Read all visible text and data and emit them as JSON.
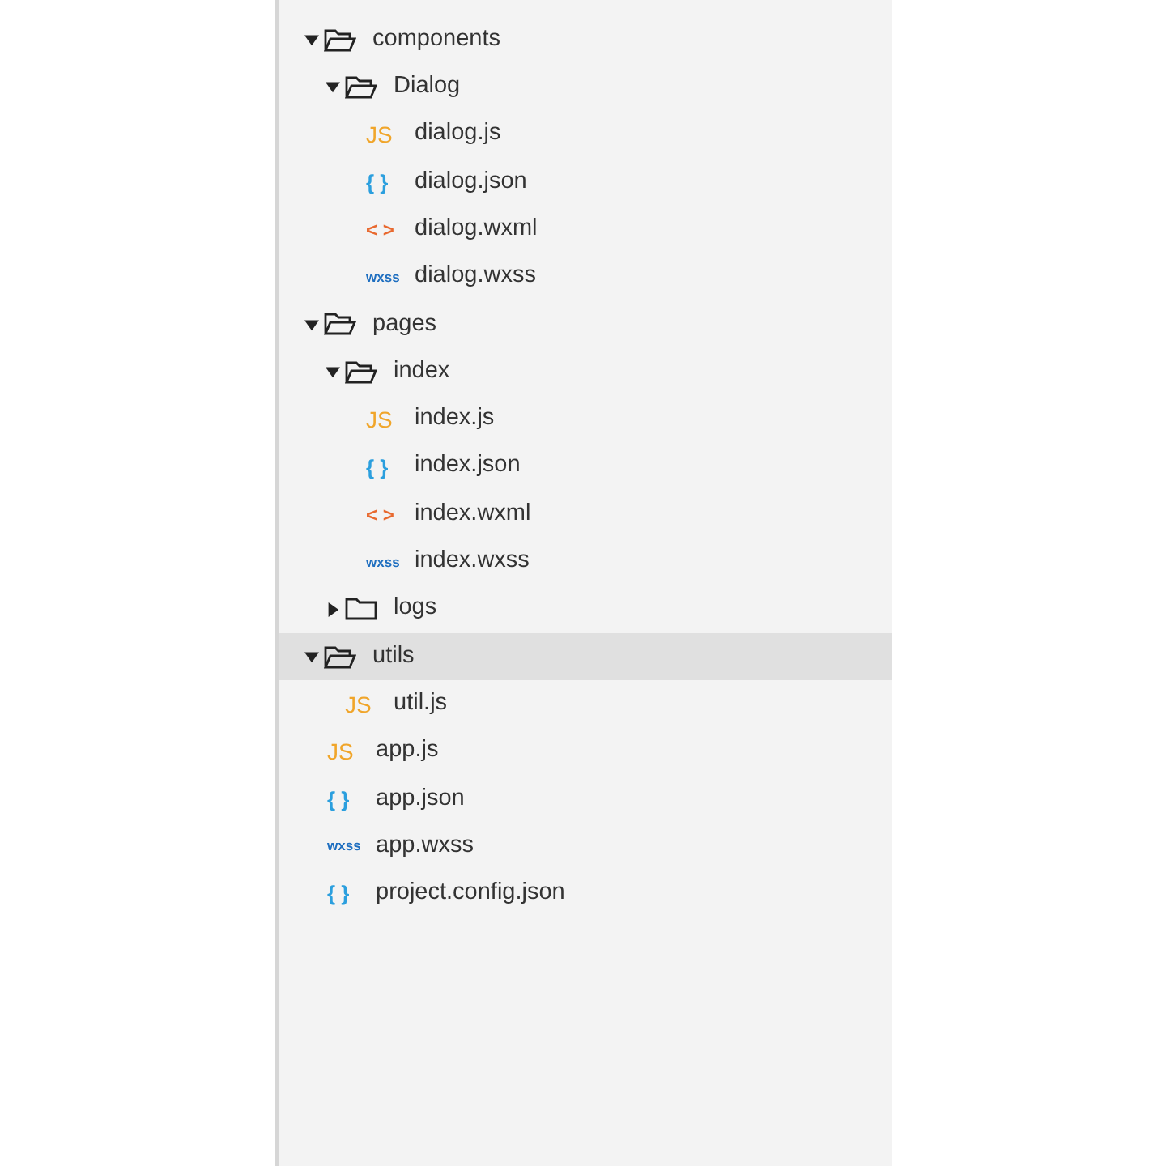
{
  "file_tree": [
    {
      "kind": "folder",
      "label": "components",
      "expanded": true,
      "selected": false,
      "children": [
        {
          "kind": "folder",
          "label": "Dialog",
          "expanded": true,
          "selected": false,
          "children": [
            {
              "kind": "js",
              "badge": "JS",
              "label": "dialog.js",
              "selected": false
            },
            {
              "kind": "json",
              "badge": "{ }",
              "label": "dialog.json",
              "selected": false
            },
            {
              "kind": "wxml",
              "badge": "< >",
              "label": "dialog.wxml",
              "selected": false
            },
            {
              "kind": "wxss",
              "badge": "wxss",
              "label": "dialog.wxss",
              "selected": false
            }
          ]
        }
      ]
    },
    {
      "kind": "folder",
      "label": "pages",
      "expanded": true,
      "selected": false,
      "children": [
        {
          "kind": "folder",
          "label": "index",
          "expanded": true,
          "selected": false,
          "children": [
            {
              "kind": "js",
              "badge": "JS",
              "label": "index.js",
              "selected": false
            },
            {
              "kind": "json",
              "badge": "{ }",
              "label": "index.json",
              "selected": false
            },
            {
              "kind": "wxml",
              "badge": "< >",
              "label": "index.wxml",
              "selected": false
            },
            {
              "kind": "wxss",
              "badge": "wxss",
              "label": "index.wxss",
              "selected": false
            }
          ]
        },
        {
          "kind": "folder",
          "label": "logs",
          "expanded": false,
          "selected": false
        }
      ]
    },
    {
      "kind": "folder",
      "label": "utils",
      "expanded": true,
      "selected": true,
      "children": [
        {
          "kind": "js",
          "badge": "JS",
          "label": "util.js",
          "selected": false
        }
      ]
    },
    {
      "kind": "js",
      "badge": "JS",
      "label": "app.js",
      "selected": false
    },
    {
      "kind": "json",
      "badge": "{ }",
      "label": "app.json",
      "selected": false
    },
    {
      "kind": "wxss",
      "badge": "wxss",
      "label": "app.wxss",
      "selected": false
    },
    {
      "kind": "json",
      "badge": "{ }",
      "label": "project.config.json",
      "selected": false
    }
  ]
}
